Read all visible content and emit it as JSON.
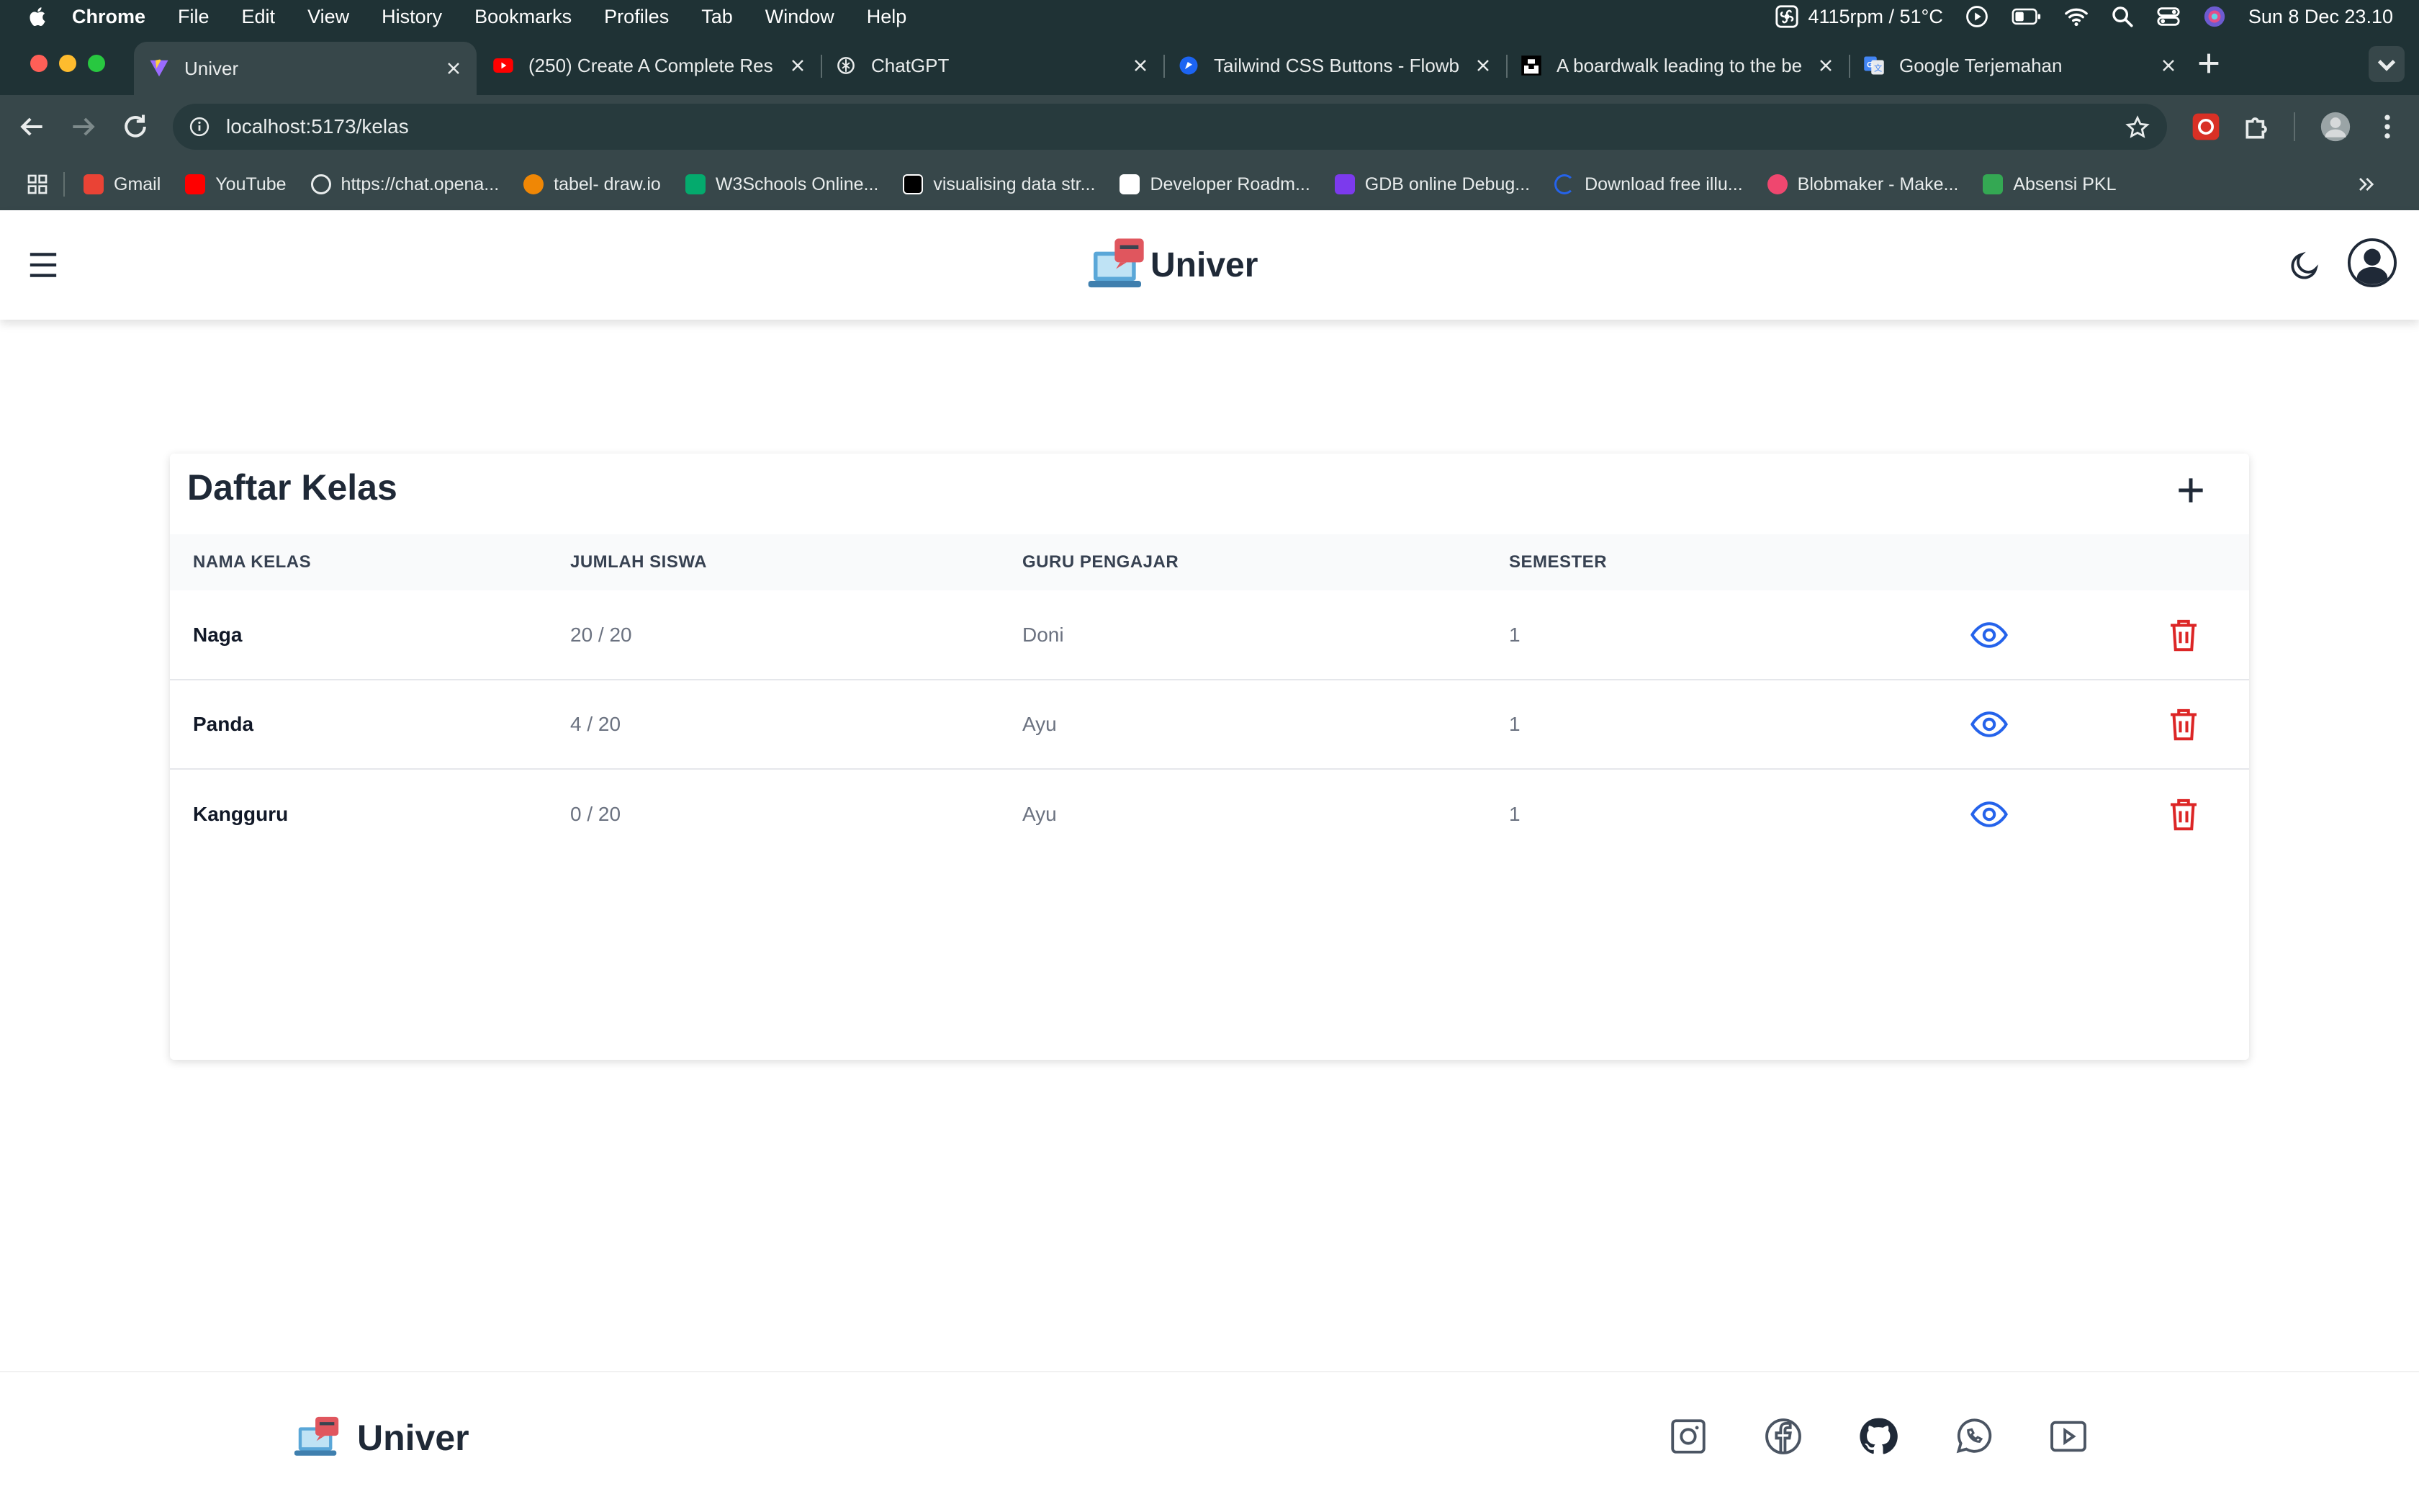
{
  "menubar": {
    "app": "Chrome",
    "items": [
      "File",
      "Edit",
      "View",
      "History",
      "Bookmarks",
      "Profiles",
      "Tab",
      "Window",
      "Help"
    ],
    "fan": "4115rpm / 51°C",
    "datetime": "Sun 8 Dec  23.10"
  },
  "tabs": [
    {
      "title": "Univer",
      "icon": "vite-icon",
      "active": true
    },
    {
      "title": "(250) Create A Complete Res",
      "icon": "youtube-icon"
    },
    {
      "title": "ChatGPT",
      "icon": "chatgpt-icon"
    },
    {
      "title": "Tailwind CSS Buttons - Flowb",
      "icon": "flowbite-icon"
    },
    {
      "title": "A boardwalk leading to the be",
      "icon": "unsplash-icon"
    },
    {
      "title": "Google Terjemahan",
      "icon": "google-translate-icon"
    }
  ],
  "toolbar": {
    "url": "localhost:5173/kelas"
  },
  "bookmarks": [
    {
      "label": "Gmail",
      "color": "#ea4335"
    },
    {
      "label": "YouTube",
      "color": "#ff0000"
    },
    {
      "label": "https://chat.opena...",
      "color": "#e8ecec"
    },
    {
      "label": "tabel- draw.io",
      "color": "#f08705"
    },
    {
      "label": "W3Schools Online...",
      "color": "#04aa6d"
    },
    {
      "label": "visualising data str...",
      "color": "#ffffff"
    },
    {
      "label": "Developer Roadm...",
      "color": "#ffffff"
    },
    {
      "label": "GDB online Debug...",
      "color": "#7c3aed"
    },
    {
      "label": "Download free illu...",
      "color": "#2563eb"
    },
    {
      "label": "Blobmaker - Make...",
      "color": "#ef476f"
    },
    {
      "label": "Absensi PKL",
      "color": "#34a853"
    }
  ],
  "navbar": {
    "brand": "Univer"
  },
  "kelas": {
    "title": "Daftar Kelas",
    "columns": [
      "NAMA KELAS",
      "JUMLAH SISWA",
      "GURU PENGAJAR",
      "SEMESTER"
    ],
    "rows": [
      {
        "nama": "Naga",
        "jumlah": "20 / 20",
        "guru": "Doni",
        "semester": "1"
      },
      {
        "nama": "Panda",
        "jumlah": "4 / 20",
        "guru": "Ayu",
        "semester": "1"
      },
      {
        "nama": "Kangguru",
        "jumlah": "0 / 20",
        "guru": "Ayu",
        "semester": "1"
      }
    ]
  },
  "footer": {
    "brand": "Univer",
    "social": [
      "instagram-icon",
      "facebook-icon",
      "github-icon",
      "whatsapp-icon",
      "youtube-icon"
    ]
  },
  "colors": {
    "accent_view": "#2563eb",
    "accent_delete": "#dc2626",
    "browser_dark": "#1f3235",
    "browser_toolbar": "#37474a"
  }
}
